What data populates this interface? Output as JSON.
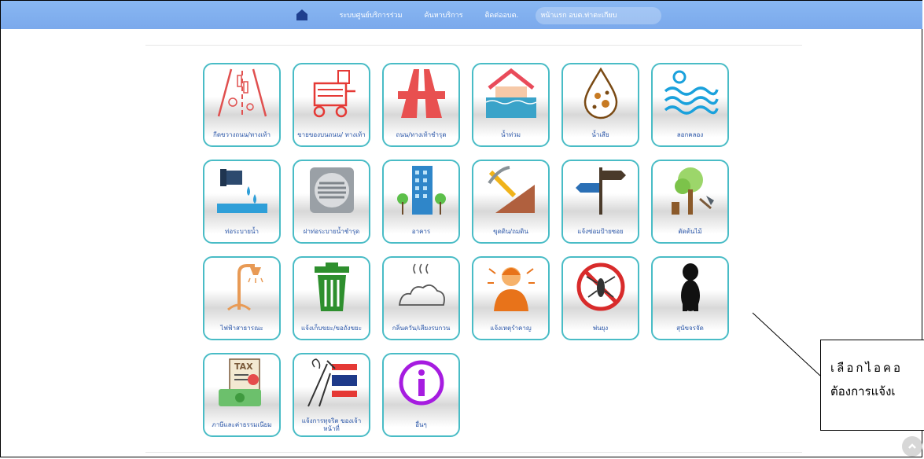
{
  "nav": {
    "items": [
      "ระบบศูนย์บริการร่วม",
      "ค้นหาบริการ",
      "ติดต่ออบต.",
      "หน้าแรก อบต.ท่าตะเกียบ"
    ],
    "bar_color": "#7eacee"
  },
  "tiles": [
    {
      "label": "กีดขวางถนน/ทางเท้า",
      "icon": "road-obstruction-icon"
    },
    {
      "label": "ขายของบนถนน/ ทางเท้า",
      "icon": "street-vendor-cart-icon"
    },
    {
      "label": "ถนน/ทางเท้าชำรุด",
      "icon": "damaged-road-icon"
    },
    {
      "label": "น้ำท่วม",
      "icon": "flood-house-icon"
    },
    {
      "label": "น้ำเสีย",
      "icon": "wastewater-drop-icon"
    },
    {
      "label": "ลอกคลอง",
      "icon": "water-waves-icon"
    },
    {
      "label": "ท่อระบายน้ำ",
      "icon": "drain-pipe-icon"
    },
    {
      "label": "ฝาท่อระบายน้ำชำรุด",
      "icon": "drain-cover-icon"
    },
    {
      "label": "อาคาร",
      "icon": "building-icon"
    },
    {
      "label": "ขุดดิน/ถมดิน",
      "icon": "pickaxe-soil-icon"
    },
    {
      "label": "แจ้งซ่อมป้ายซอย",
      "icon": "signpost-icon"
    },
    {
      "label": "ตัดต้นไม้",
      "icon": "tree-axe-icon"
    },
    {
      "label": "ไฟฟ้าสาธารณะ",
      "icon": "street-lamp-icon"
    },
    {
      "label": "แจ้งเก็บขยะ/ขอถังขยะ",
      "icon": "trash-bin-icon"
    },
    {
      "label": "กลิ่นควัน/เสียงรบกวน",
      "icon": "smell-noise-icon"
    },
    {
      "label": "แจ้งเหตุรำคาญ",
      "icon": "annoyed-person-icon"
    },
    {
      "label": "พ่นยุง",
      "icon": "no-mosquito-icon"
    },
    {
      "label": "สุนัขจรจัด",
      "icon": "stray-dog-icon"
    },
    {
      "label": "ภาษีและค่าธรรมเนียม",
      "icon": "tax-document-icon"
    },
    {
      "label": "แจ้งการทุจริต ของเจ้าหน้าที่",
      "icon": "corruption-report-icon"
    },
    {
      "label": "อื่นๆ",
      "icon": "info-circle-icon"
    }
  ],
  "callout": {
    "line1": "เลือกไอคอ",
    "line2": "ต้องการแจ้งเ"
  },
  "colors": {
    "tile_border": "#49bcc6",
    "label": "#2a56a8"
  }
}
